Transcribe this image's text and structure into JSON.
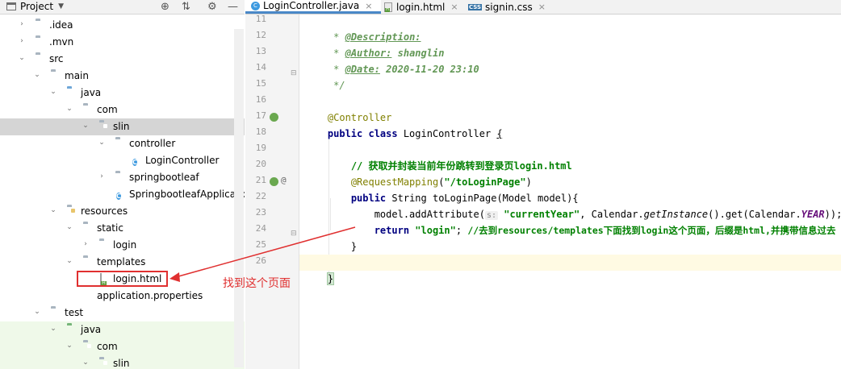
{
  "project_panel": {
    "title": "Project",
    "tree": [
      {
        "label": ".idea",
        "icon": "folder-icon",
        "expanded": false
      },
      {
        "label": ".mvn",
        "icon": "folder-icon",
        "expanded": false
      },
      {
        "label": "src",
        "icon": "folder-icon",
        "expanded": true
      },
      {
        "label": "main",
        "icon": "folder-icon",
        "expanded": true
      },
      {
        "label": "java",
        "icon": "source-folder-icon",
        "expanded": true
      },
      {
        "label": "com",
        "icon": "package-icon",
        "expanded": true
      },
      {
        "label": "slin",
        "icon": "package-icon",
        "expanded": true
      },
      {
        "label": "controller",
        "icon": "package-icon",
        "expanded": true
      },
      {
        "label": "LoginController",
        "icon": "java-class-icon"
      },
      {
        "label": "springbootleaf",
        "icon": "package-icon",
        "expanded": false
      },
      {
        "label": "SpringbootleafApplication",
        "icon": "java-class-icon"
      },
      {
        "label": "resources",
        "icon": "resources-folder-icon",
        "expanded": true
      },
      {
        "label": "static",
        "icon": "folder-icon",
        "expanded": true
      },
      {
        "label": "login",
        "icon": "folder-icon",
        "expanded": false
      },
      {
        "label": "templates",
        "icon": "folder-icon",
        "expanded": true
      },
      {
        "label": "login.html",
        "icon": "html-file-icon"
      },
      {
        "label": "application.properties",
        "icon": "properties-file-icon"
      },
      {
        "label": "test",
        "icon": "folder-icon",
        "expanded": true
      },
      {
        "label": "java",
        "icon": "test-folder-icon",
        "expanded": true
      },
      {
        "label": "com",
        "icon": "package-icon",
        "expanded": true
      },
      {
        "label": "slin",
        "icon": "package-icon",
        "expanded": true
      }
    ]
  },
  "tabs": [
    {
      "label": "LoginController.java",
      "active": true
    },
    {
      "label": "login.html",
      "active": false
    },
    {
      "label": "signin.css",
      "active": false
    }
  ],
  "editor": {
    "line_numbers": [
      "11",
      "12",
      "13",
      "14",
      "15",
      "16",
      "17",
      "18",
      "19",
      "20",
      "21",
      "22",
      "23",
      "24",
      "25",
      "26"
    ],
    "lines": {
      "l11": {
        "star": " * ",
        "tag": "@Description:"
      },
      "l12": {
        "star": " * ",
        "tag": "@Author:",
        "value": " shanglin"
      },
      "l13": {
        "star": " * ",
        "tag": "@Date:",
        "value": " 2020-11-20 23:10"
      },
      "l14": {
        "text": " */"
      },
      "l16": {
        "annotation": "@Controller"
      },
      "l17": {
        "kw": "public class",
        "name": " LoginController ",
        "brace": "{"
      },
      "l19": {
        "indent": "    ",
        "comment": "// ",
        "comment_cn": "获取并封装当前年份跳转到登录页login.html"
      },
      "l20": {
        "indent": "    ",
        "annotation": "@RequestMapping",
        "open": "(",
        "str": "\"/toLoginPage\"",
        "close": ")"
      },
      "l21": {
        "indent": "    ",
        "kw": "public",
        "rest": " String toLoginPage(Model model){"
      },
      "l22": {
        "indent": "        ",
        "pre": "model.addAttribute(",
        "hint": "s:",
        "str": " \"currentYear\"",
        "mid": ", Calendar.",
        "method": "getInstance",
        "mid2": "().get(Calendar.",
        "static": "YEAR",
        "end": "));"
      },
      "l23": {
        "indent": "        ",
        "kw": "return",
        "str": " \"login\"",
        "semi": "; ",
        "comment_cn": "//去到resources/templates下面找到login这个页面，后缀是html,并携带信息过去"
      },
      "l24": {
        "indent": "    ",
        "text": "}"
      },
      "l26": {
        "text": "}"
      }
    }
  },
  "annotation": {
    "text": "找到这个页面",
    "color": "#e03030"
  }
}
